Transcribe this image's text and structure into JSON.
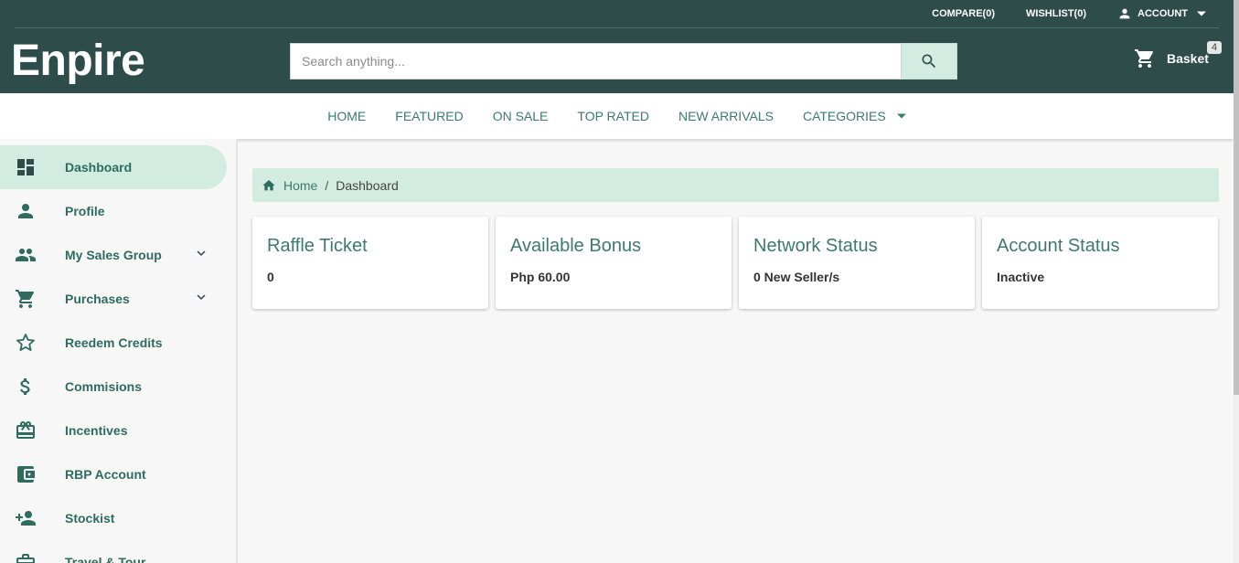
{
  "header": {
    "logo": "Enpire",
    "links": {
      "compare": "COMPARE(0)",
      "wishlist": "WISHLIST(0)",
      "account": "ACCOUNT"
    },
    "search": {
      "placeholder": "Search anything...",
      "value": ""
    },
    "basket": {
      "label": "Basket",
      "count": "4"
    }
  },
  "nav": {
    "items": [
      "HOME",
      "FEATURED",
      "ON SALE",
      "TOP RATED",
      "NEW ARRIVALS",
      "CATEGORIES"
    ]
  },
  "sidebar": {
    "items": [
      {
        "label": "Dashboard",
        "icon": "dashboard-icon"
      },
      {
        "label": "Profile",
        "icon": "person-icon"
      },
      {
        "label": "My Sales Group",
        "icon": "group-icon"
      },
      {
        "label": "Purchases",
        "icon": "cart-icon"
      },
      {
        "label": "Reedem Credits",
        "icon": "star-icon"
      },
      {
        "label": "Commisions",
        "icon": "dollar-icon"
      },
      {
        "label": "Incentives",
        "icon": "gift-card-icon"
      },
      {
        "label": "RBP Account",
        "icon": "wallet-icon"
      },
      {
        "label": "Stockist",
        "icon": "person-add-icon"
      },
      {
        "label": "Travel & Tour",
        "icon": "luggage-icon"
      }
    ]
  },
  "breadcrumb": {
    "home": "Home",
    "separator": "/",
    "current": "Dashboard"
  },
  "cards": [
    {
      "title": "Raffle Ticket",
      "value": "0"
    },
    {
      "title": "Available Bonus",
      "value": "Php 60.00"
    },
    {
      "title": "Network Status",
      "value": "0 New Seller/s"
    },
    {
      "title": "Account Status",
      "value": "Inactive"
    }
  ],
  "colors": {
    "header": "#2e4d4a",
    "accent": "#3d7a6c",
    "highlight": "#d2ece2"
  }
}
